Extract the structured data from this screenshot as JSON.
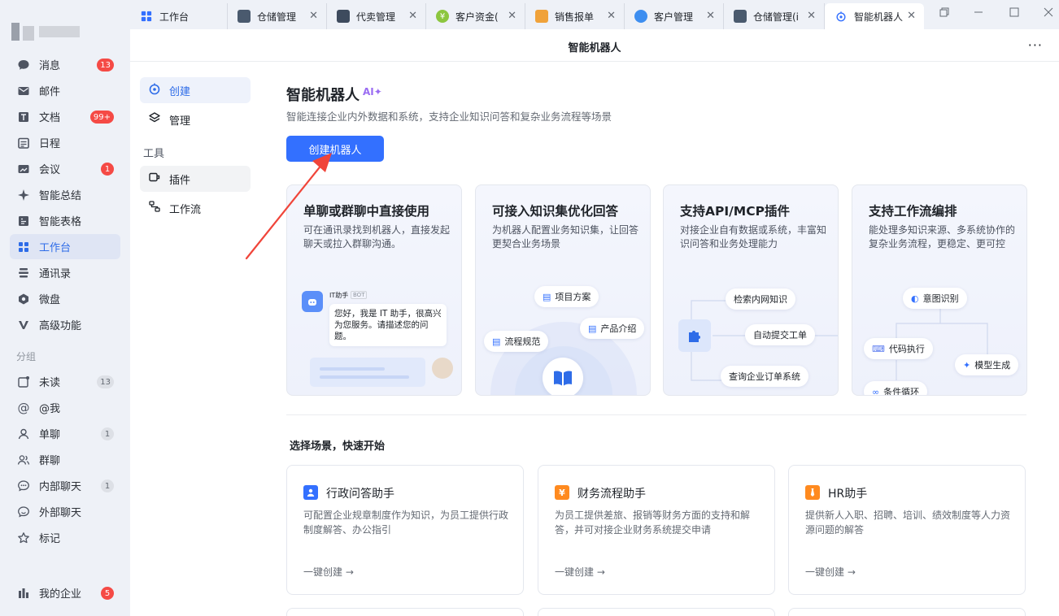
{
  "sidebar": {
    "items": [
      {
        "label": "消息",
        "badge": "13"
      },
      {
        "label": "邮件"
      },
      {
        "label": "文档",
        "badge": "99+"
      },
      {
        "label": "日程"
      },
      {
        "label": "会议",
        "badge": "1"
      },
      {
        "label": "智能总结"
      },
      {
        "label": "智能表格"
      },
      {
        "label": "工作台"
      },
      {
        "label": "通讯录"
      },
      {
        "label": "微盘"
      },
      {
        "label": "高级功能"
      }
    ],
    "group_label": "分组",
    "groups": [
      {
        "label": "未读",
        "count": "13"
      },
      {
        "label": "@我"
      },
      {
        "label": "单聊",
        "count": "1"
      },
      {
        "label": "群聊"
      },
      {
        "label": "内部聊天",
        "count": "1"
      },
      {
        "label": "外部聊天"
      },
      {
        "label": "标记"
      }
    ],
    "enterprise": {
      "label": "我的企业",
      "badge": "5"
    }
  },
  "tabs": [
    {
      "label": "工作台"
    },
    {
      "label": "仓储管理"
    },
    {
      "label": "代卖管理"
    },
    {
      "label": "客户资金("
    },
    {
      "label": "销售报单"
    },
    {
      "label": "客户管理"
    },
    {
      "label": "仓储管理(i"
    },
    {
      "label": "智能机器人"
    }
  ],
  "page": {
    "title": "智能机器人",
    "more": "···"
  },
  "subnav": {
    "create": "创建",
    "manage": "管理",
    "tools_label": "工具",
    "plugin": "插件",
    "workflow": "工作流"
  },
  "hero": {
    "title": "智能机器人",
    "ai_tag": "AI✦",
    "desc": "智能连接企业内外数据和系统，支持企业知识问答和复杂业务流程等场景",
    "create_button": "创建机器人"
  },
  "features": [
    {
      "title": "单聊或群聊中直接使用",
      "desc": "可在通讯录找到机器人，直接发起聊天或拉入群聊沟通。",
      "bot_name": "IT助手",
      "bot_tag": "BOT",
      "bot_message": "您好，我是 IT 助手，很高兴为您服务。请描述您的问题。"
    },
    {
      "title": "可接入知识集优化回答",
      "desc": "为机器人配置业务知识集，让回答更契合业务场景",
      "pills": [
        "项目方案",
        "流程规范",
        "产品介绍"
      ]
    },
    {
      "title": "支持API/MCP插件",
      "desc": "对接企业自有数据或系统，丰富知识问答和业务处理能力",
      "pills": [
        "检索内网知识",
        "自动提交工单",
        "查询企业订单系统"
      ]
    },
    {
      "title": "支持工作流编排",
      "desc": "能处理多知识来源、多系统协作的复杂业务流程，更稳定、更可控",
      "pills": [
        "意图识别",
        "代码执行",
        "模型生成",
        "条件循环"
      ]
    }
  ],
  "scenes": {
    "title": "选择场景，快速开始",
    "items": [
      {
        "title": "行政问答助手",
        "desc": "可配置企业规章制度作为知识，为员工提供行政制度解答、办公指引",
        "link": "一键创建 →",
        "icon_color": "#3370ff",
        "icon": "👤"
      },
      {
        "title": "财务流程助手",
        "desc": "为员工提供差旅、报销等财务方面的支持和解答，并可对接企业财务系统提交申请",
        "link": "一键创建 →",
        "icon_color": "#ff8a1f",
        "icon": "¥"
      },
      {
        "title": "HR助手",
        "desc": "提供新人入职、招聘、培训、绩效制度等人力资源问题的解答",
        "link": "一键创建 →",
        "icon_color": "#ff8a1f",
        "icon": "i"
      }
    ]
  },
  "colors": {
    "accent": "#3370ff",
    "badge": "#f54a45",
    "arrow": "#f0453a"
  }
}
